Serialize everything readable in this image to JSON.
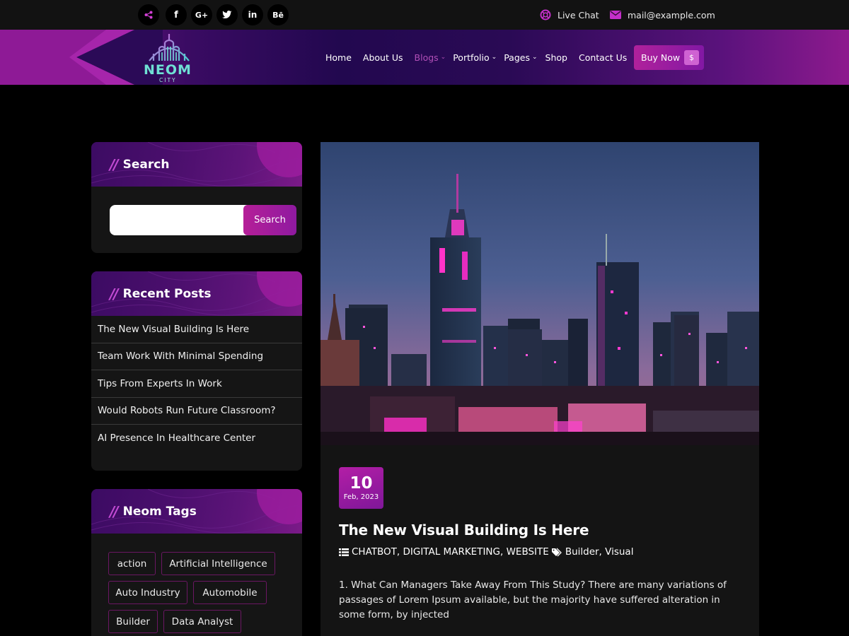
{
  "topbar": {
    "social": [
      "share-icon",
      "facebook-icon",
      "google-plus-icon",
      "twitter-icon",
      "linkedin-icon",
      "behance-icon"
    ],
    "social_glyphs": [
      "⋖",
      "f",
      "G+",
      "t",
      "in",
      "Bē"
    ],
    "live_chat": "Live Chat",
    "email": "mail@example.com"
  },
  "header": {
    "logo_text": "NEOM",
    "logo_sub": "CITY",
    "nav": [
      {
        "label": "Home",
        "dropdown": false
      },
      {
        "label": "About Us",
        "dropdown": false
      },
      {
        "label": "Blogs",
        "dropdown": true,
        "active": true
      },
      {
        "label": "Portfolio",
        "dropdown": true
      },
      {
        "label": "Pages",
        "dropdown": true
      },
      {
        "label": "Shop",
        "dropdown": false
      },
      {
        "label": "Contact Us",
        "dropdown": false
      }
    ],
    "buy_now": "Buy Now",
    "buy_icon": "$"
  },
  "sidebar": {
    "search": {
      "title": "Search",
      "placeholder": "",
      "button": "Search"
    },
    "recent_posts": {
      "title": "Recent Posts",
      "items": [
        "The New Visual Building Is Here",
        "Team Work With Minimal Spending",
        "Tips From Experts In Work",
        "Would Robots Run Future Classroom?",
        "AI Presence In Healthcare Center"
      ]
    },
    "tags": {
      "title": "Neom Tags",
      "items": [
        "action",
        "Artificial Intelligence",
        "Auto Industry",
        "Automobile",
        "Builder",
        "Data Analyst"
      ]
    }
  },
  "post": {
    "date_day": "10",
    "date_month": "Feb, 2023",
    "title": "The New Visual Building Is Here",
    "categories": "CHATBOT, DIGITAL MARKETING, WEBSITE",
    "tags": "Builder, Visual",
    "excerpt": "1. What Can Managers Take Away From This Study? There are many variations of passages of Lorem Ipsum available, but the majority have suffered alteration in some form, by injected"
  },
  "colors": {
    "accent": "#b11fa0",
    "background": "#000000",
    "card": "#151515"
  }
}
